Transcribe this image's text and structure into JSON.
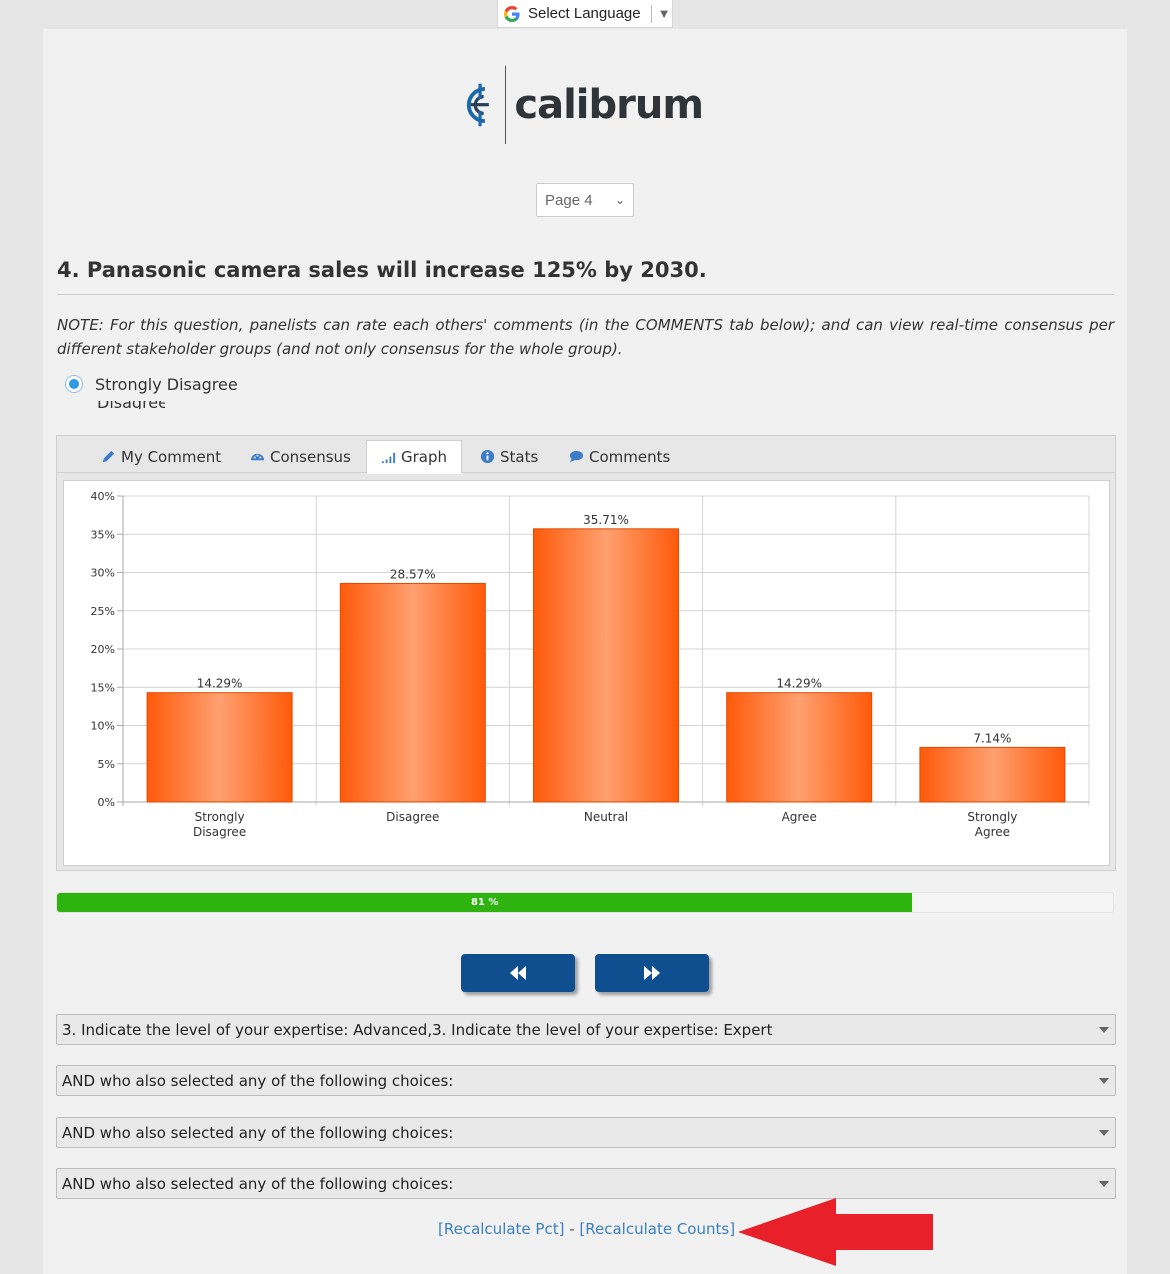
{
  "language_bar": {
    "label": "Select Language",
    "icon": "google-g-icon"
  },
  "logo": {
    "word": "calibrum",
    "colors": {
      "mark": "#1a6aab",
      "word": "#2f3438"
    }
  },
  "page_selector": {
    "value": "Page 4"
  },
  "question": {
    "title": "4. Panasonic camera sales will increase 125% by 2030.",
    "note": "NOTE: For this question, panelists can rate each others' comments (in the COMMENTS tab below); and can view real-time consensus per different stakeholder groups (and not only consensus for the whole group).",
    "options": [
      {
        "label": "Strongly Disagree",
        "selected": true
      },
      {
        "label": "Disagree",
        "selected": false
      }
    ]
  },
  "tabs": [
    {
      "label": "My Comment",
      "icon": "pencil-icon",
      "active": false
    },
    {
      "label": "Consensus",
      "icon": "dashboard-icon",
      "active": false
    },
    {
      "label": "Graph",
      "icon": "bar-signal-icon",
      "active": true
    },
    {
      "label": "Stats",
      "icon": "info-icon",
      "active": false
    },
    {
      "label": "Comments",
      "icon": "comment-bubble-icon",
      "active": false
    }
  ],
  "chart_data": {
    "type": "bar",
    "categories": [
      "Strongly Disagree",
      "Disagree",
      "Neutral",
      "Agree",
      "Strongly Agree"
    ],
    "category_lines": [
      [
        "Strongly",
        "Disagree"
      ],
      [
        "Disagree"
      ],
      [
        "Neutral"
      ],
      [
        "Agree"
      ],
      [
        "Strongly",
        "Agree"
      ]
    ],
    "values": [
      14.29,
      28.57,
      35.71,
      14.29,
      7.14
    ],
    "value_labels": [
      "14.29%",
      "28.57%",
      "35.71%",
      "14.29%",
      "7.14%"
    ],
    "ylim": [
      0,
      40
    ],
    "yticks": [
      "0%",
      "5%",
      "10%",
      "15%",
      "20%",
      "25%",
      "30%",
      "35%",
      "40%"
    ],
    "ytick_values": [
      0,
      5,
      10,
      15,
      20,
      25,
      30,
      35,
      40
    ],
    "grid": true,
    "bar_color": "#ff5a0a",
    "bar_highlight": "#ffa070"
  },
  "progress": {
    "value": 81,
    "label": "81 %",
    "color": "#2fb40f"
  },
  "navigation": {
    "prev_icon": "rewind-icon",
    "next_icon": "fast-forward-icon"
  },
  "filters": [
    "3. Indicate the level of your expertise: Advanced,3. Indicate the level of your expertise: Expert",
    "AND who also selected any of the following choices:",
    "AND who also selected any of the following choices:",
    "AND who also selected any of the following choices:"
  ],
  "links": {
    "recalc_pct": "[Recalculate Pct]",
    "separator": " - ",
    "recalc_counts": "[Recalculate Counts]"
  },
  "annotation": {
    "arrow_color": "#e8202a"
  }
}
